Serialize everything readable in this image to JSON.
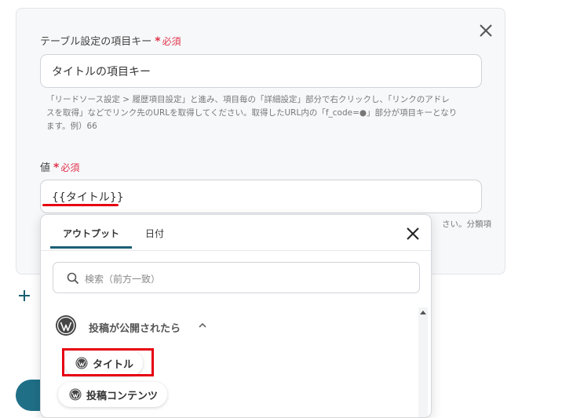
{
  "field1": {
    "label": "テーブル設定の項目キー",
    "required": "必須",
    "value": "タイトルの項目キー",
    "help": [
      "「リードソース設定 > 履歴項目設定」と進み、項目毎の「詳細設定」部分で右クリックし、「リンクのアドレ",
      "スを取得」などでリンク先のURLを取得してください。取得したURL内の「f_code=●」部分が項目キーとなり",
      "ます。例）66"
    ]
  },
  "field2": {
    "label": "値",
    "required": "必須",
    "value": "{{タイトル}}",
    "help_cut": "さい。分類項"
  },
  "popup": {
    "tabs": [
      "アウトプット",
      "日付"
    ],
    "search_placeholder": "検索（前方一致）",
    "section_title": "投稿が公開されたら",
    "items": [
      "タイトル",
      "投稿コンテンツ"
    ]
  },
  "icons": {
    "close": "close-icon",
    "plus": "plus-icon",
    "search": "search-icon",
    "wordpress": "wordpress-icon",
    "chevron": "chevron-up-icon"
  },
  "colors": {
    "required": "#e0334b",
    "accent": "#1b5f74",
    "highlight": "#e60012"
  }
}
